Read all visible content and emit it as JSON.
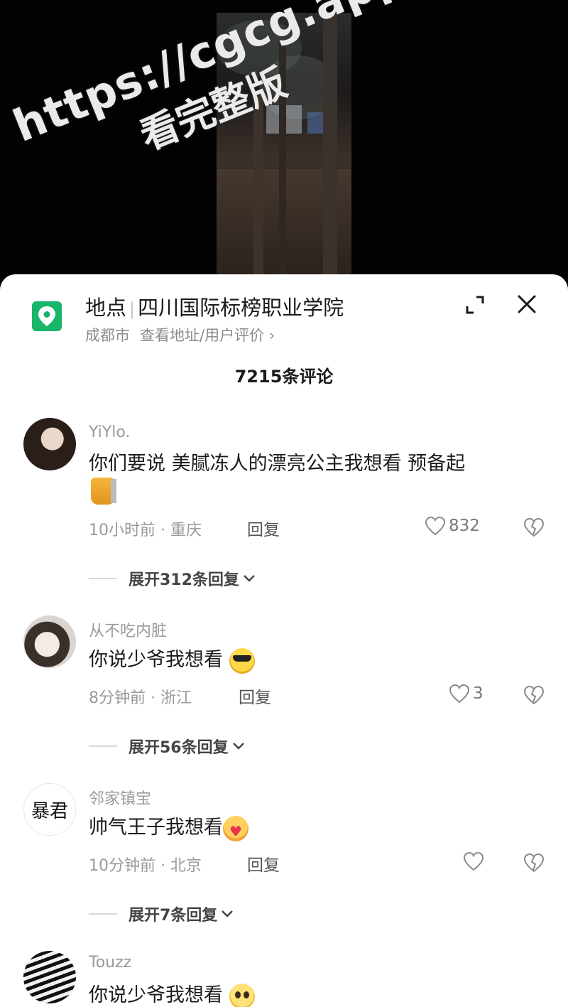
{
  "watermark": {
    "line1": "https://cgcg.app",
    "line2": "看完整版"
  },
  "location": {
    "label": "地点",
    "name": "四川国际标榜职业学院",
    "city": "成都市",
    "link": "查看地址/用户评价 ›"
  },
  "comments_title": "7215条评论",
  "comments": [
    {
      "user": "YiYlo.",
      "text": "你们要说 美腻冻人的漂亮公主我想看 预备起",
      "time_location": "10小时前 · 重庆",
      "reply_label": "回复",
      "likes": "832",
      "expand": "展开312条回复"
    },
    {
      "user": "从不吃内脏",
      "text": "你说少爷我想看",
      "time_location": "8分钟前 · 浙江",
      "reply_label": "回复",
      "likes": "3",
      "expand": "展开56条回复"
    },
    {
      "user": "邻家镇宝",
      "avatar_text": "暴君",
      "text": "帅气王子我想看",
      "time_location": "10分钟前 · 北京",
      "reply_label": "回复",
      "likes": "",
      "expand": "展开7条回复"
    },
    {
      "user": "Touzz",
      "text": "你说少爷我想看"
    }
  ],
  "icons": {
    "location": "map-pin-icon",
    "expand": "expand-icon",
    "close": "close-icon",
    "like": "heart-icon",
    "dislike": "broken-heart-icon",
    "chevron": "chevron-down-icon"
  },
  "colors": {
    "pin_green": "#19b56a",
    "text_primary": "#1a1a1a",
    "text_secondary": "#9a9a9a"
  }
}
